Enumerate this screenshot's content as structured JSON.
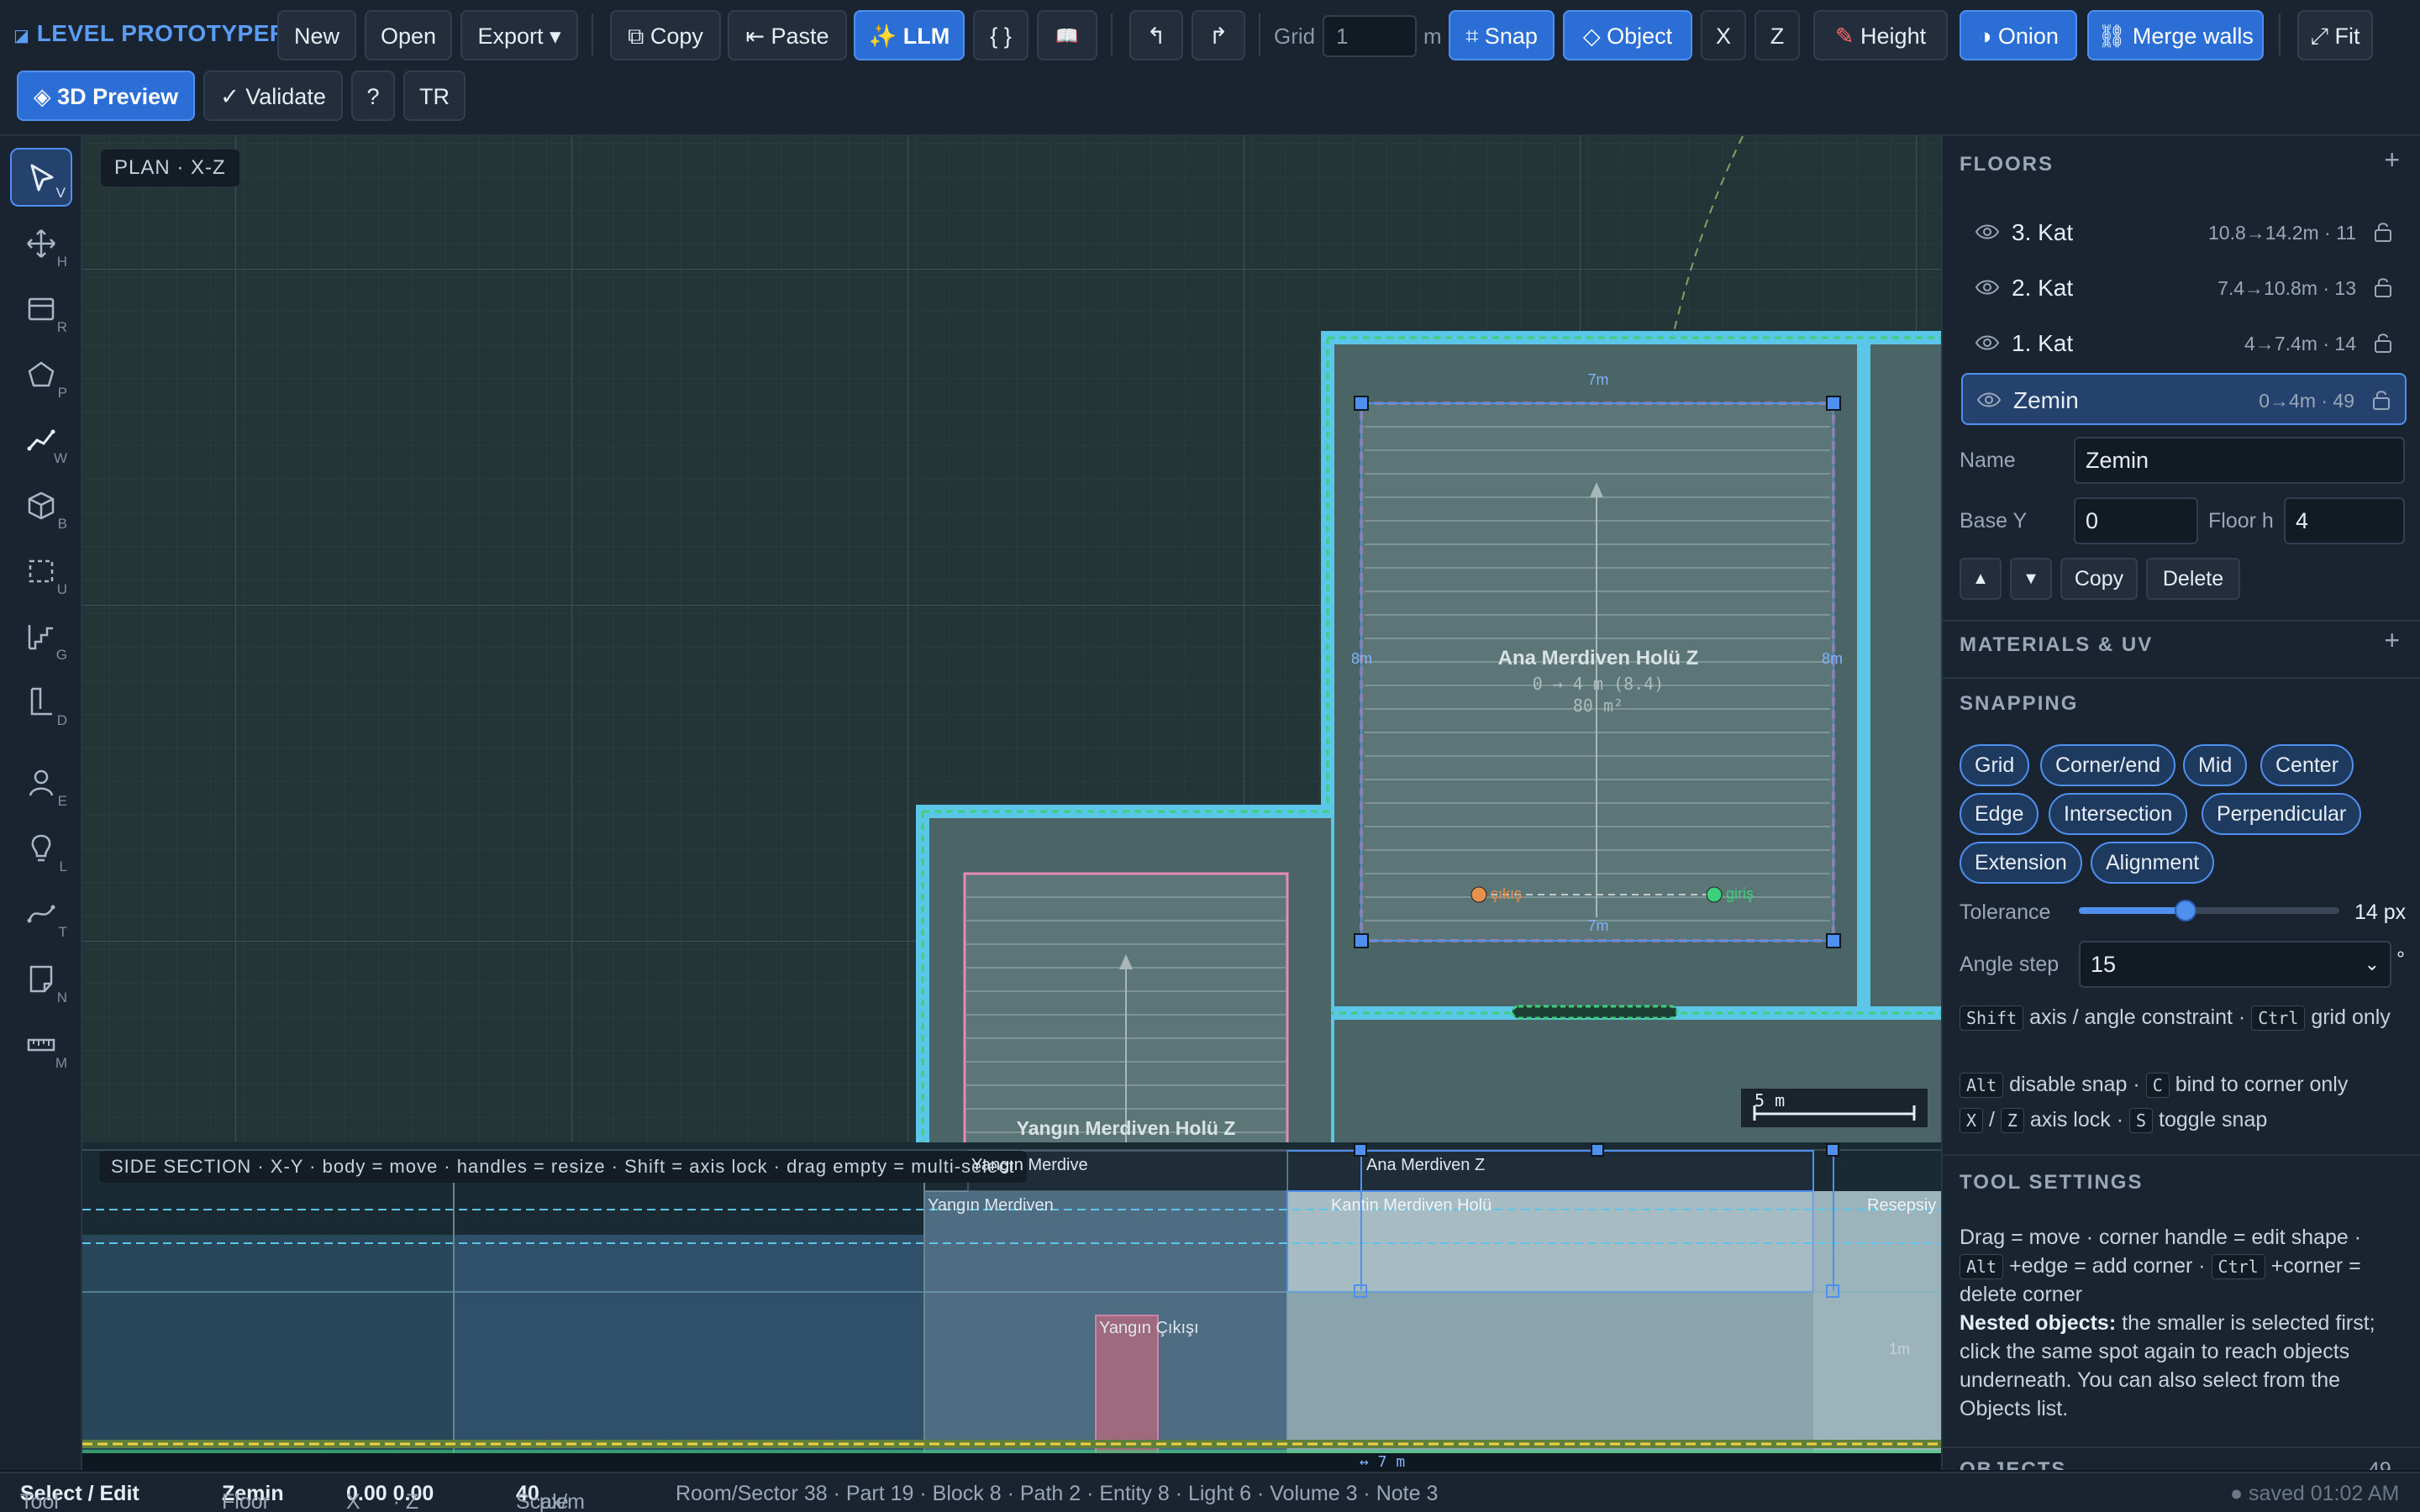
{
  "app": {
    "name": "LEVEL PROTOTYPER"
  },
  "toolbar": {
    "new": "New",
    "open": "Open",
    "export": "Export ▾",
    "copy": "⧉ Copy",
    "paste": "⇤ Paste",
    "llm": "✨ LLM",
    "json": "{ }",
    "docs": "📖",
    "undo": "↰",
    "redo": "↱",
    "grid_label": "Grid",
    "grid_value": "1",
    "grid_unit": "m",
    "snap": "⌗ Snap",
    "object": "◇ Object",
    "x_lock": "X",
    "z_lock": "Z",
    "height": "Height",
    "onion": "◑ Onion",
    "merge_walls": "⛓ Merge walls",
    "fit": "⤢ Fit",
    "preview_3d": "◈ 3D Preview",
    "validate": "✓ Validate",
    "help": "?",
    "lang": "TR"
  },
  "tools": [
    {
      "name": "select",
      "key": "V",
      "icon": "cursor-icon",
      "active": true
    },
    {
      "name": "move",
      "key": "H",
      "icon": "move-icon"
    },
    {
      "name": "room",
      "key": "R",
      "icon": "room-icon"
    },
    {
      "name": "polygon",
      "key": "P",
      "icon": "polygon-icon"
    },
    {
      "name": "wall",
      "key": "W",
      "icon": "wall-icon"
    },
    {
      "name": "block",
      "key": "B",
      "icon": "cube-icon"
    },
    {
      "name": "volume",
      "key": "U",
      "icon": "volume-icon"
    },
    {
      "name": "stairs",
      "key": "G",
      "icon": "stairs-icon"
    },
    {
      "name": "door",
      "key": "D",
      "icon": "door-icon"
    },
    {
      "name": "entity",
      "key": "E",
      "icon": "person-icon"
    },
    {
      "name": "light",
      "key": "L",
      "icon": "bulb-icon"
    },
    {
      "name": "path",
      "key": "T",
      "icon": "path-icon"
    },
    {
      "name": "note",
      "key": "N",
      "icon": "note-icon"
    },
    {
      "name": "measure",
      "key": "M",
      "icon": "ruler-icon"
    }
  ],
  "canvas": {
    "plan_tag": "PLAN · X-Z",
    "room_main_title": "Ana Merdiven Holü Z",
    "room_main_sub": "0 → 4 m (8.4)",
    "room_main_area": "80 m²",
    "dim_top": "7m",
    "dim_bottom": "7m",
    "dim_left": "8m",
    "dim_right": "8m",
    "exit_label": "çıkış",
    "entry_label": "giriş",
    "fire_stair_label": "Yangın Merdiven Holü Z",
    "scale_label": "5 m",
    "section_tag": "SIDE SECTION · X-Y · body = move · handles = resize · Shift = axis lock · drag empty = multi-select",
    "sec_labels": {
      "fire_stair_top": "Yangın Merdive",
      "main_stair_top": "Ana Merdiven Z",
      "fire_stair_mid": "Yangın Merdiven",
      "main_hall_mid": "Kantin Merdiven Holü",
      "reception": "Resepsiy",
      "fire_exit": "Yangın Çıkışı",
      "dim_7m": "↔ 7 m",
      "one_m": "1m"
    }
  },
  "panel": {
    "floors_title": "FLOORS",
    "floors": [
      {
        "name": "3. Kat",
        "meta": "10.8→14.2m · 11"
      },
      {
        "name": "2. Kat",
        "meta": "7.4→10.8m · 13"
      },
      {
        "name": "1. Kat",
        "meta": "4→7.4m · 14"
      },
      {
        "name": "Zemin",
        "meta": "0→4m · 49",
        "selected": true
      }
    ],
    "name_label": "Name",
    "name_value": "Zemin",
    "base_y_label": "Base Y",
    "base_y_value": "0",
    "floor_h_label": "Floor h",
    "floor_h_value": "4",
    "up": "▲",
    "down": "▼",
    "copy": "Copy",
    "delete": "Delete",
    "materials_title": "MATERIALS & UV",
    "snapping_title": "SNAPPING",
    "snap_chips": [
      "Grid",
      "Corner/end",
      "Mid",
      "Center",
      "Edge",
      "Intersection",
      "Perpendicular",
      "Extension",
      "Alignment"
    ],
    "tolerance_label": "Tolerance",
    "tolerance_value": "14 px",
    "tolerance_fraction": 0.41,
    "angle_label": "Angle step",
    "angle_value": "15",
    "angle_unit": "°",
    "hint1_key1": "Shift",
    "hint1_text1": "axis / angle constraint ·",
    "hint1_key2": "Ctrl",
    "hint1_text2": "grid only",
    "hint2_key1": "Alt",
    "hint2_text1": "disable snap ·",
    "hint2_key2": "C",
    "hint2_text2": "bind to corner only",
    "hint3_key1": "X",
    "hint3_sep": "/",
    "hint3_key2": "Z",
    "hint3_text1": "axis lock ·",
    "hint3_key3": "S",
    "hint3_text2": "toggle snap",
    "tool_settings_title": "TOOL SETTINGS",
    "ts_line1": "Drag = move · corner handle = edit shape ·",
    "ts_key_alt": "Alt",
    "ts_line2": "+edge = add corner ·",
    "ts_key_ctrl": "Ctrl",
    "ts_line3": "+corner =",
    "ts_line4": "delete corner",
    "ts_nested_bold": "Nested objects:",
    "ts_nested": "the smaller is selected first; click the same spot again to reach objects underneath. You can also select from the Objects list.",
    "objects_title": "OBJECTS",
    "objects_count": "49"
  },
  "status": {
    "tool_label": "Tool",
    "tool_value": "Select / Edit",
    "floor_label": "Floor",
    "floor_value": "Zemin",
    "x_label": "X",
    "x_value": "0.00",
    "z_label": "· Z",
    "z_value": "0.00",
    "scale_label": "Scale",
    "scale_value": "40",
    "scale_unit": "px/m",
    "counts": "Room/Sector 38 · Part 19 · Block 8 · Path 2 · Entity 8 · Light 6 · Volume 3 · Note 3",
    "saved": "● saved 01:02 AM"
  }
}
